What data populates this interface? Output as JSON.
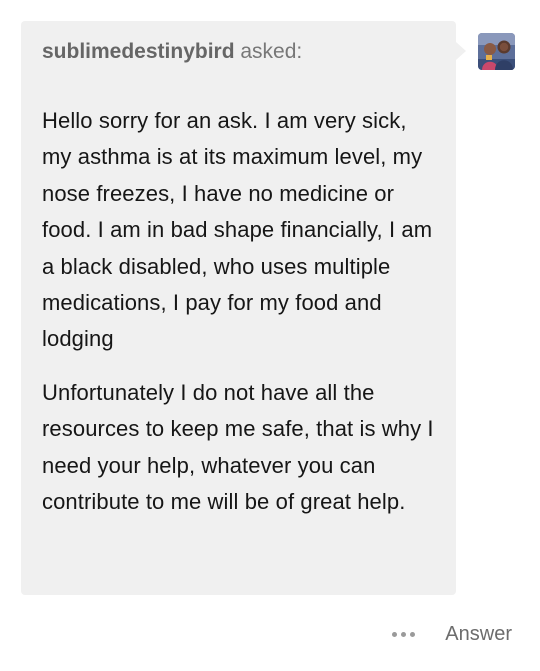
{
  "ask": {
    "asker_name": "sublimedestinybird",
    "asker_suffix": " asked:",
    "paragraphs": [
      "Hello sorry for an ask. I am very sick, my asthma is at its maximum level, my nose freezes, I have no medicine or food. I am in bad shape financially, I am a black disabled, who uses multiple medications, I pay for my food and lodging",
      "Unfortunately I do not have all the resources to keep me safe, that is why I need your help, whatever you can contribute to me will be of great help."
    ]
  },
  "footer": {
    "more_icon": "more-dots-icon",
    "answer_label": "Answer"
  },
  "colors": {
    "bubble_background": "#f0f0f0",
    "body_text": "#161616",
    "muted_text": "#6c6c6c"
  }
}
